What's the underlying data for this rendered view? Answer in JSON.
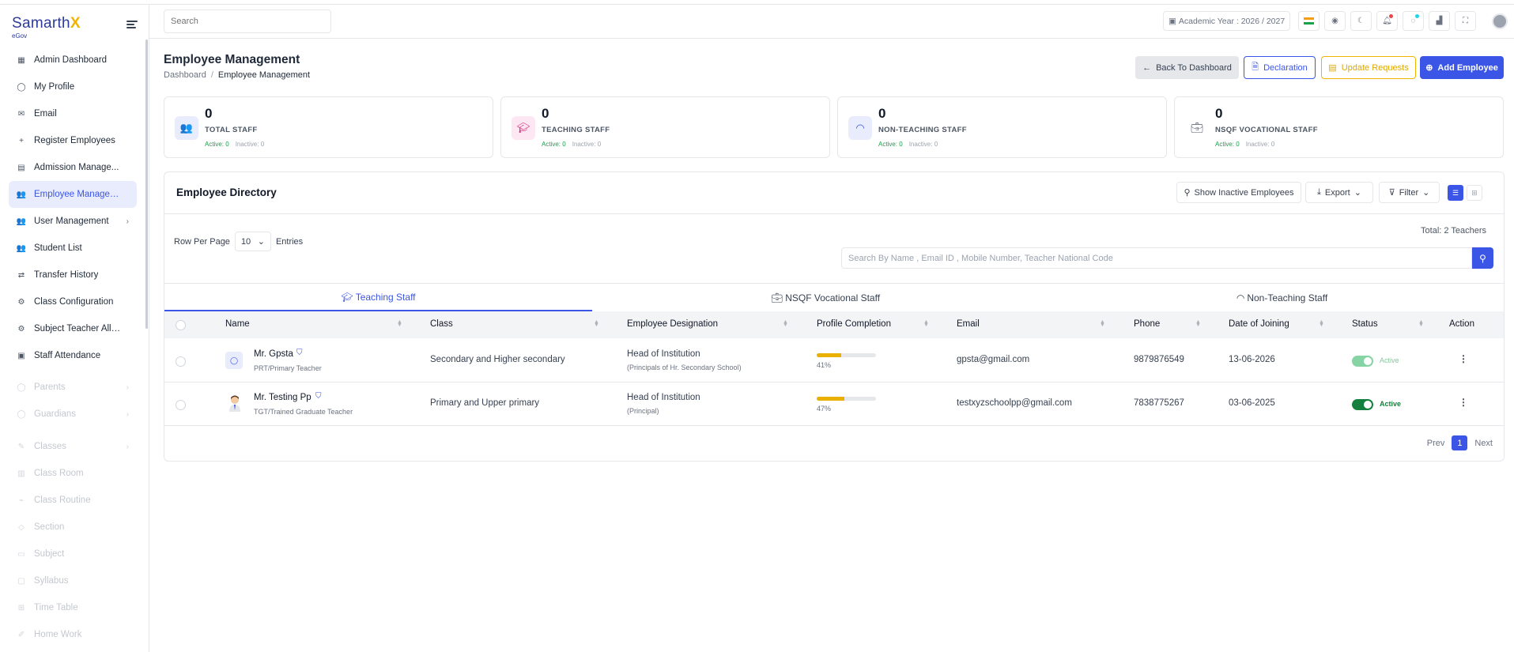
{
  "brand": {
    "name_a": "Samarth",
    "name_b": "X",
    "sub": "eGov"
  },
  "sidebar": {
    "items": [
      {
        "label": "Admin Dashboard",
        "icon": "grid-icon"
      },
      {
        "label": "My Profile",
        "icon": "user-icon"
      },
      {
        "label": "Email",
        "icon": "mail-icon"
      },
      {
        "label": "Register Employees",
        "icon": "plus-icon"
      },
      {
        "label": "Admission Manage...",
        "icon": "clipboard-icon"
      },
      {
        "label": "Employee Managem...",
        "icon": "users-icon"
      },
      {
        "label": "User Management",
        "icon": "users-icon"
      },
      {
        "label": "Student List",
        "icon": "users-icon"
      },
      {
        "label": "Transfer History",
        "icon": "transfer-icon"
      },
      {
        "label": "Class Configuration",
        "icon": "gear-icon"
      },
      {
        "label": "Subject Teacher Allo...",
        "icon": "gear-icon"
      },
      {
        "label": "Staff Attendance",
        "icon": "calendar-icon"
      },
      {
        "label": "Parents",
        "icon": "user-icon"
      },
      {
        "label": "Guardians",
        "icon": "user-icon"
      },
      {
        "label": "Classes",
        "icon": "book-icon"
      },
      {
        "label": "Class Room",
        "icon": "room-icon"
      },
      {
        "label": "Class Routine",
        "icon": "routine-icon"
      },
      {
        "label": "Section",
        "icon": "section-icon"
      },
      {
        "label": "Subject",
        "icon": "book-icon"
      },
      {
        "label": "Syllabus",
        "icon": "syllabus-icon"
      },
      {
        "label": "Time Table",
        "icon": "table-icon"
      },
      {
        "label": "Home Work",
        "icon": "homework-icon"
      }
    ]
  },
  "topbar": {
    "search_placeholder": "Search",
    "academic_year": "Academic Year : 2026 / 2027"
  },
  "header": {
    "title": "Employee Management",
    "breadcrumb": [
      "Dashboard",
      "Employee Management"
    ],
    "back_label": "Back To Dashboard",
    "declaration_label": "Declaration",
    "update_label": "Update Requests",
    "add_label": "Add Employee"
  },
  "stats": [
    {
      "value": "0",
      "label": "TOTAL STAFF",
      "active": "Active: 0",
      "inactive": "Inactive: 0",
      "color": "#3b55e6"
    },
    {
      "value": "0",
      "label": "TEACHING STAFF",
      "active": "Active: 0",
      "inactive": "Inactive: 0",
      "color": "#db2777"
    },
    {
      "value": "0",
      "label": "NON-TEACHING STAFF",
      "active": "Active: 0",
      "inactive": "Inactive: 0",
      "color": "#3b55e6"
    },
    {
      "value": "0",
      "label": "NSQF VOCATIONAL STAFF",
      "active": "Active: 0",
      "inactive": "Inactive: 0",
      "color": "#4b5563"
    }
  ],
  "directory": {
    "title": "Employee Directory",
    "show_inactive": "Show Inactive Employees",
    "export": "Export",
    "filter": "Filter",
    "rows_per_page": "Row Per Page",
    "rows_value": "10",
    "entries": "Entries",
    "total": "Total: 2 Teachers",
    "search_placeholder": "Search By Name , Email ID , Mobile Number, Teacher National Code",
    "tabs": [
      "Teaching Staff",
      "NSQF Vocational Staff",
      "Non-Teaching Staff"
    ],
    "columns": [
      "Name",
      "Class",
      "Employee Designation",
      "Profile Completion",
      "Email",
      "Phone",
      "Date of Joining",
      "Status",
      "Action"
    ],
    "rows": [
      {
        "name": "Mr. Gpsta",
        "role": "PRT/Primary Teacher",
        "class": "Secondary and Higher secondary",
        "designation": "Head of Institution",
        "designation_sub": "(Principals of Hr. Secondary School)",
        "completion": "41%",
        "completion_value": 41,
        "email": "gpsta@gmail.com",
        "phone": "9879876549",
        "doj": "13-06-2026",
        "status": "Active"
      },
      {
        "name": "Mr. Testing Pp",
        "role": "TGT/Trained Graduate Teacher",
        "class": "Primary and Upper primary",
        "designation": "Head of Institution",
        "designation_sub": "(Principal)",
        "completion": "47%",
        "completion_value": 47,
        "email": "testxyzschoolpp@gmail.com",
        "phone": "7838775267",
        "doj": "03-06-2025",
        "status": "Active"
      }
    ],
    "pager": {
      "prev": "Prev",
      "current": "1",
      "next": "Next"
    }
  },
  "colors": {
    "accent": "#3b55e6",
    "warning": "#f0b400",
    "success": "#16a34a"
  }
}
